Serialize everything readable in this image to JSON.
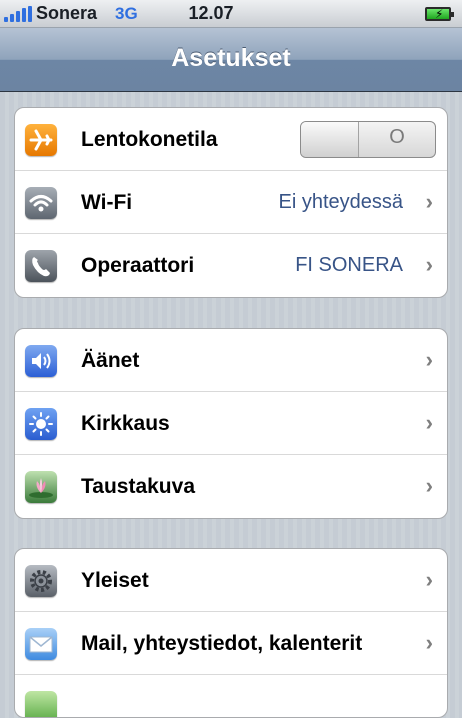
{
  "status_bar": {
    "carrier": "Sonera",
    "network": "3G",
    "time": "12.07"
  },
  "nav": {
    "title": "Asetukset"
  },
  "groups": [
    {
      "rows": [
        {
          "label": "Lentokonetila",
          "icon": "airplane-icon",
          "toggle_label": "O",
          "toggle_on": false
        },
        {
          "label": "Wi-Fi",
          "icon": "wifi-icon",
          "value": "Ei yhteydessä"
        },
        {
          "label": "Operaattori",
          "icon": "phone-icon",
          "value": "FI SONERA"
        }
      ]
    },
    {
      "rows": [
        {
          "label": "Äänet",
          "icon": "speaker-icon"
        },
        {
          "label": "Kirkkaus",
          "icon": "brightness-icon"
        },
        {
          "label": "Taustakuva",
          "icon": "wallpaper-icon"
        }
      ]
    },
    {
      "rows": [
        {
          "label": "Yleiset",
          "icon": "gear-icon"
        },
        {
          "label": "Mail, yhteystiedot, kalenterit",
          "icon": "mail-icon"
        },
        {
          "label": "",
          "icon": "app-icon"
        }
      ]
    }
  ],
  "chevron": "›",
  "colors": {
    "nav_bar": "#6c84a2",
    "value_text": "#385487",
    "network_text": "#2f6fe0",
    "background": "#c5ccd4"
  }
}
